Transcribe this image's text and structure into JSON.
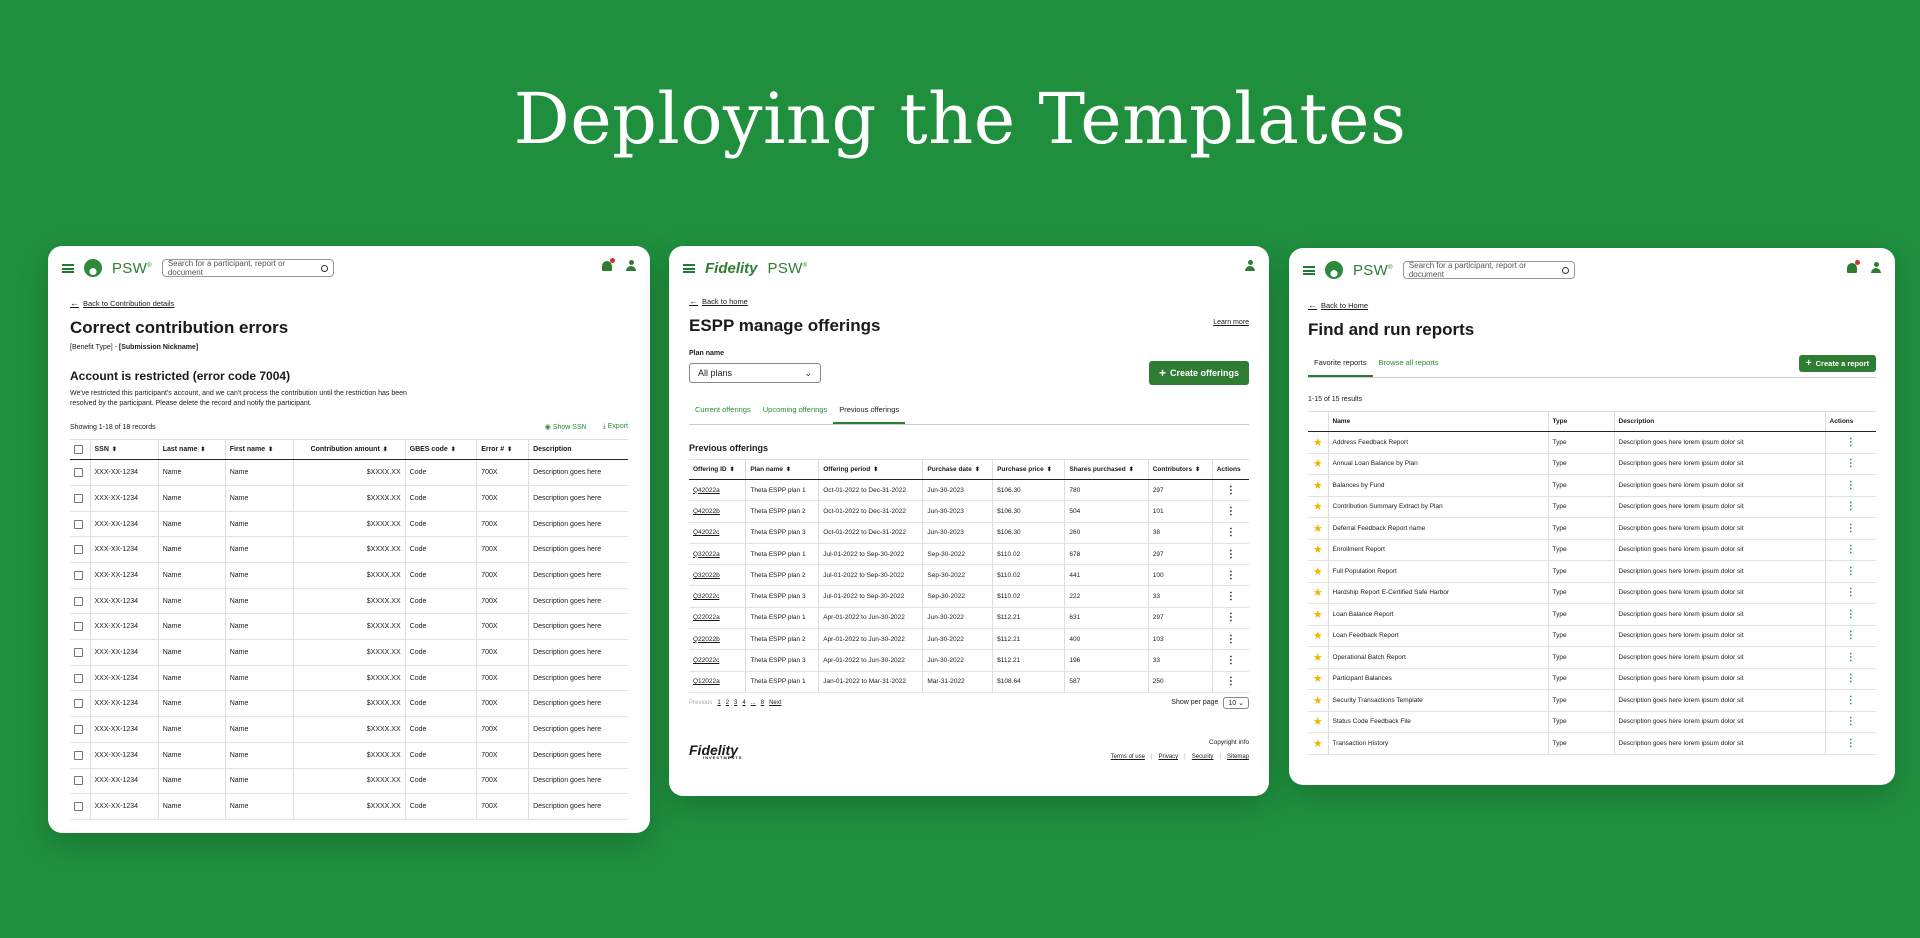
{
  "hero_title": "Deploying the Templates",
  "colors": {
    "background": "#1f8f3e",
    "brand_green": "#2e7d32",
    "link_green": "#2e8a3a",
    "star": "#f2b600"
  },
  "panel1": {
    "psw": "PSW",
    "search_placeholder": "Search for a participant, report or document",
    "back_link": "Back to Contribution details",
    "title": "Correct contribution errors",
    "subtitle_a": "[Benefit Type] - ",
    "subtitle_b": "[Submission Nickname]",
    "alert_title": "Account is restricted (error code 7004)",
    "alert_body": "We've restricted this participant's account, and we can't process the contribution until the restriction has been resolved by the participant. Please delete the record and notify the participant.",
    "showing": "Showing 1-18 of 18 records",
    "show_ssn": "Show SSN",
    "export": "Export",
    "columns": [
      "SSN",
      "Last name",
      "First name",
      "Contribution amount",
      "GBES code",
      "Error #",
      "Description"
    ],
    "rows": [
      [
        "XXX-XX-1234",
        "Name",
        "Name",
        "$XXXX.XX",
        "Code",
        "700X",
        "Description goes here"
      ],
      [
        "XXX-XX-1234",
        "Name",
        "Name",
        "$XXXX.XX",
        "Code",
        "700X",
        "Description goes here"
      ],
      [
        "XXX-XX-1234",
        "Name",
        "Name",
        "$XXXX.XX",
        "Code",
        "700X",
        "Description goes here"
      ],
      [
        "XXX-XX-1234",
        "Name",
        "Name",
        "$XXXX.XX",
        "Code",
        "700X",
        "Description goes here"
      ],
      [
        "XXX-XX-1234",
        "Name",
        "Name",
        "$XXXX.XX",
        "Code",
        "700X",
        "Description goes here"
      ],
      [
        "XXX-XX-1234",
        "Name",
        "Name",
        "$XXXX.XX",
        "Code",
        "700X",
        "Description goes here"
      ],
      [
        "XXX-XX-1234",
        "Name",
        "Name",
        "$XXXX.XX",
        "Code",
        "700X",
        "Description goes here"
      ],
      [
        "XXX-XX-1234",
        "Name",
        "Name",
        "$XXXX.XX",
        "Code",
        "700X",
        "Description goes here"
      ],
      [
        "XXX-XX-1234",
        "Name",
        "Name",
        "$XXXX.XX",
        "Code",
        "700X",
        "Description goes here"
      ],
      [
        "XXX-XX-1234",
        "Name",
        "Name",
        "$XXXX.XX",
        "Code",
        "700X",
        "Description goes here"
      ],
      [
        "XXX-XX-1234",
        "Name",
        "Name",
        "$XXXX.XX",
        "Code",
        "700X",
        "Description goes here"
      ],
      [
        "XXX-XX-1234",
        "Name",
        "Name",
        "$XXXX.XX",
        "Code",
        "700X",
        "Description goes here"
      ],
      [
        "XXX-XX-1234",
        "Name",
        "Name",
        "$XXXX.XX",
        "Code",
        "700X",
        "Description goes here"
      ],
      [
        "XXX-XX-1234",
        "Name",
        "Name",
        "$XXXX.XX",
        "Code",
        "700X",
        "Description goes here"
      ]
    ]
  },
  "panel2": {
    "fidelity": "Fidelity",
    "psw": "PSW",
    "back_link": "Back to home",
    "learn_more": "Learn more",
    "title": "ESPP manage offerings",
    "plan_label": "Plan name",
    "plan_value": "All plans",
    "create_button": "Create offerings",
    "tabs": [
      "Current offerings",
      "Upcoming offerings",
      "Previous offerings"
    ],
    "section_title": "Previous offerings",
    "columns": [
      "Offering ID",
      "Plan name",
      "Offering period",
      "Purchase date",
      "Purchase price",
      "Shares purchased",
      "Contributors",
      "Actions"
    ],
    "rows": [
      [
        "Q42022a",
        "Theta ESPP plan 1",
        "Oct-01-2022 to Dec-31-2022",
        "Jun-30-2023",
        "$106.30",
        "780",
        "297"
      ],
      [
        "Q42022b",
        "Theta ESPP plan 2",
        "Oct-01-2022 to Dec-31-2022",
        "Jun-30-2023",
        "$106.30",
        "504",
        "101"
      ],
      [
        "Q42022c",
        "Theta ESPP plan 3",
        "Oct-01-2022 to Dec-31-2022",
        "Jun-30-2023",
        "$106.30",
        "260",
        "38"
      ],
      [
        "Q32022a",
        "Theta ESPP plan 1",
        "Jul-01-2022 to Sep-30-2022",
        "Sep-30-2022",
        "$110.02",
        "678",
        "297"
      ],
      [
        "Q32022b",
        "Theta ESPP plan 2",
        "Jul-01-2022 to Sep-30-2022",
        "Sep-30-2022",
        "$110.02",
        "441",
        "100"
      ],
      [
        "Q32022c",
        "Theta ESPP plan 3",
        "Jul-01-2022 to Sep-30-2022",
        "Sep-30-2022",
        "$110.02",
        "222",
        "33"
      ],
      [
        "Q22022a",
        "Theta ESPP plan 1",
        "Apr-01-2022 to Jun-30-2022",
        "Jun-30-2022",
        "$112.21",
        "631",
        "297"
      ],
      [
        "Q22022b",
        "Theta ESPP plan 2",
        "Apr-01-2022 to Jun-30-2022",
        "Jun-30-2022",
        "$112.21",
        "400",
        "103"
      ],
      [
        "Q22022c",
        "Theta ESPP plan 3",
        "Apr-01-2022 to Jun-30-2022",
        "Jun-30-2022",
        "$112.21",
        "196",
        "33"
      ],
      [
        "Q12022a",
        "Theta ESPP plan 1",
        "Jan-01-2022 to Mar-31-2022",
        "Mar-31-2022",
        "$108.64",
        "587",
        "250"
      ]
    ],
    "pager_prev": "Previous",
    "pager_pages": [
      "1",
      "2",
      "3",
      "4",
      "...",
      "8"
    ],
    "pager_next": "Next",
    "per_page_label": "Show per page",
    "per_page_value": "10",
    "footer_logo": "Fidelity",
    "footer_logo_sub": "INVESTMENTS",
    "copyright": "Copyright info",
    "footer_links": [
      "Terms of use",
      "Privacy",
      "Security",
      "Sitemap"
    ]
  },
  "panel3": {
    "psw": "PSW",
    "search_placeholder": "Search for a participant, report or document",
    "back_link": "Back to Home",
    "title": "Find and run reports",
    "tabs": [
      "Favorite reports",
      "Browse all reports"
    ],
    "create_button": "Create a report",
    "results": "1-15 of 15 results",
    "columns": [
      "Name",
      "Type",
      "Description",
      "Actions"
    ],
    "rows": [
      [
        "Address Feedback Report",
        "Type",
        "Description goes here lorem ipsum dolor sit"
      ],
      [
        "Annual Loan Balance by Plan",
        "Type",
        "Description goes here lorem ipsum dolor sit"
      ],
      [
        "Balances by Fund",
        "Type",
        "Description goes here lorem ipsum dolor sit"
      ],
      [
        "Contribution Summary Extract by Plan",
        "Type",
        "Description goes here lorem ipsum dolor sit"
      ],
      [
        "Deferral Feedback Report name",
        "Type",
        "Description goes here lorem ipsum dolor sit"
      ],
      [
        "Enrollment Report",
        "Type",
        "Description goes here lorem ipsum dolor sit"
      ],
      [
        "Full Population Report",
        "Type",
        "Description goes here lorem ipsum dolor sit"
      ],
      [
        "Hardship Report E-Certified Safe Harbor",
        "Type",
        "Description goes here lorem ipsum dolor sit"
      ],
      [
        "Loan Balance Report",
        "Type",
        "Description goes here lorem ipsum dolor sit"
      ],
      [
        "Loan Feedback Report",
        "Type",
        "Description goes here lorem ipsum dolor sit"
      ],
      [
        "Operational Batch Report",
        "Type",
        "Description goes here lorem ipsum dolor sit"
      ],
      [
        "Participant Balances",
        "Type",
        "Description goes here lorem ipsum dolor sit"
      ],
      [
        "Security Transactions Template",
        "Type",
        "Description goes here lorem ipsum dolor sit"
      ],
      [
        "Status Code Feedback File",
        "Type",
        "Description goes here lorem ipsum dolor sit"
      ],
      [
        "Transaction History",
        "Type",
        "Description goes here lorem ipsum dolor sit"
      ]
    ]
  }
}
